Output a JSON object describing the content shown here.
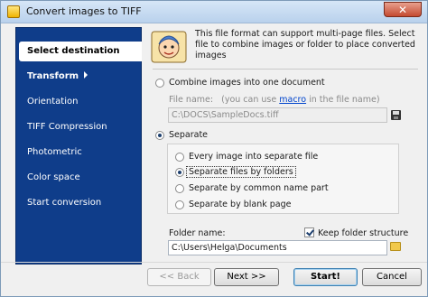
{
  "window": {
    "title": "Convert images to TIFF",
    "close_label": "✕"
  },
  "sidebar": {
    "items": [
      {
        "label": "Select destination",
        "state": "active"
      },
      {
        "label": "Transform",
        "state": "bold"
      },
      {
        "label": "Orientation"
      },
      {
        "label": "TIFF Compression"
      },
      {
        "label": "Photometric"
      },
      {
        "label": "Color space"
      },
      {
        "label": "Start conversion"
      }
    ]
  },
  "description": "This file format can support multi-page files. Select file to combine images or folder to place converted images",
  "combine": {
    "label": "Combine images into one document",
    "file_name_prefix": "File name:",
    "file_name_hint_before": "(you can use",
    "macro_link": "macro",
    "file_name_hint_after": "in the file name)",
    "file_value": "C:\\DOCS\\SampleDocs.tiff"
  },
  "separate": {
    "label": "Separate",
    "options": [
      {
        "label": "Every image into separate file"
      },
      {
        "label": "Separate files by folders"
      },
      {
        "label": "Separate by common name part"
      },
      {
        "label": "Separate by blank page"
      }
    ]
  },
  "folder": {
    "label": "Folder name:",
    "keep_structure_label": "Keep folder structure",
    "value": "C:\\Users\\Helga\\Documents"
  },
  "buttons": {
    "back": "<< Back",
    "next": "Next >>",
    "start": "Start!",
    "cancel": "Cancel"
  }
}
